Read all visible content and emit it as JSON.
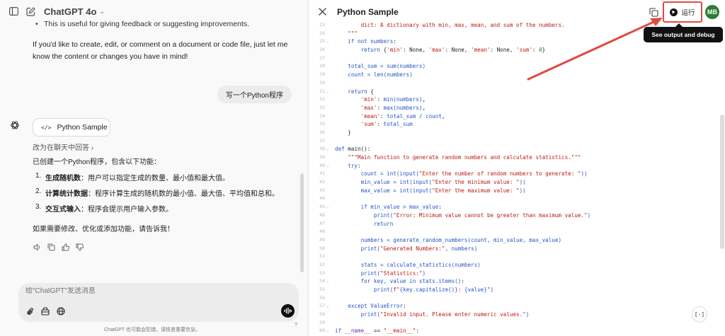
{
  "chat": {
    "model_name": "ChatGPT 4o",
    "cut_bullet": "This is useful for giving feedback or suggesting improvements.",
    "paragraph": "If you'd like to create, edit, or comment on a document or code file, just let me know the content or changes you have in mind!",
    "user_message": "写一个Python程序",
    "code_chip_label": "Python Sample",
    "reply_in_chat": "改为在聊天中回答",
    "intro": "已创建一个Python程序，包含以下功能：",
    "features": [
      {
        "num": "1.",
        "title": "生成随机数",
        "desc": "：用户可以指定生成的数量、最小值和最大值。"
      },
      {
        "num": "2.",
        "title": "计算统计数据",
        "desc": "：程序计算生成的随机数的最小值、最大值、平均值和总和。"
      },
      {
        "num": "3.",
        "title": "交互式输入",
        "desc": "：程序会提示用户输入参数。"
      }
    ],
    "outro": "如果需要修改、优化或添加功能，请告诉我！",
    "composer_placeholder": "给\"ChatGPT\"发送消息",
    "disclaimer": "ChatGPT 也可能会犯错。请核查重要信息。",
    "help": "?"
  },
  "editor": {
    "title": "Python Sample",
    "run_label": "运行",
    "tooltip": "See output and debug",
    "avatar_initials": "MB",
    "expand_label": "[-]",
    "lines": [
      {
        "n": "23",
        "fold": "",
        "segs": [
          {
            "c": "c-s",
            "t": "        dict: A dictionary with min, max, mean, and sum of the numbers."
          }
        ]
      },
      {
        "n": "24",
        "fold": "",
        "segs": [
          {
            "c": "c-s",
            "t": "    \"\"\""
          }
        ]
      },
      {
        "n": "25",
        "fold": "v",
        "segs": [
          {
            "c": "c-k",
            "t": "    if not "
          },
          {
            "c": "c-b",
            "t": "numbers"
          },
          {
            "c": "c-d",
            "t": ":"
          }
        ]
      },
      {
        "n": "26",
        "fold": "",
        "segs": [
          {
            "c": "c-k",
            "t": "        return "
          },
          {
            "c": "c-d",
            "t": "{"
          },
          {
            "c": "c-s",
            "t": "'min'"
          },
          {
            "c": "c-d",
            "t": ": None, "
          },
          {
            "c": "c-s",
            "t": "'max'"
          },
          {
            "c": "c-d",
            "t": ": None, "
          },
          {
            "c": "c-s",
            "t": "'mean'"
          },
          {
            "c": "c-d",
            "t": ": None, "
          },
          {
            "c": "c-s",
            "t": "'sum'"
          },
          {
            "c": "c-d",
            "t": ": "
          },
          {
            "c": "c-n",
            "t": "0"
          },
          {
            "c": "c-d",
            "t": "}"
          }
        ]
      },
      {
        "n": "27",
        "fold": "",
        "segs": []
      },
      {
        "n": "28",
        "fold": "",
        "segs": [
          {
            "c": "c-b",
            "t": "    total_sum = sum(numbers)"
          }
        ]
      },
      {
        "n": "29",
        "fold": "",
        "segs": [
          {
            "c": "c-b",
            "t": "    count = len(numbers)"
          }
        ]
      },
      {
        "n": "30",
        "fold": "",
        "segs": []
      },
      {
        "n": "31",
        "fold": "v",
        "segs": [
          {
            "c": "c-k",
            "t": "    return "
          },
          {
            "c": "c-d",
            "t": "{"
          }
        ]
      },
      {
        "n": "32",
        "fold": "",
        "segs": [
          {
            "c": "c-s",
            "t": "        'min'"
          },
          {
            "c": "c-d",
            "t": ": "
          },
          {
            "c": "c-b",
            "t": "min(numbers)"
          },
          {
            "c": "c-d",
            "t": ","
          }
        ]
      },
      {
        "n": "33",
        "fold": "",
        "segs": [
          {
            "c": "c-s",
            "t": "        'max'"
          },
          {
            "c": "c-d",
            "t": ": "
          },
          {
            "c": "c-b",
            "t": "max(numbers)"
          },
          {
            "c": "c-d",
            "t": ","
          }
        ]
      },
      {
        "n": "34",
        "fold": "",
        "segs": [
          {
            "c": "c-s",
            "t": "        'mean'"
          },
          {
            "c": "c-d",
            "t": ": "
          },
          {
            "c": "c-b",
            "t": "total_sum / count"
          },
          {
            "c": "c-d",
            "t": ","
          }
        ]
      },
      {
        "n": "35",
        "fold": "",
        "segs": [
          {
            "c": "c-s",
            "t": "        'sum'"
          },
          {
            "c": "c-d",
            "t": ": "
          },
          {
            "c": "c-b",
            "t": "total_sum"
          }
        ]
      },
      {
        "n": "36",
        "fold": "",
        "segs": [
          {
            "c": "c-d",
            "t": "    }"
          }
        ]
      },
      {
        "n": "37",
        "fold": "",
        "segs": []
      },
      {
        "n": "38",
        "fold": "v",
        "segs": [
          {
            "c": "c-k",
            "t": "def "
          },
          {
            "c": "c-d",
            "t": "main():"
          }
        ]
      },
      {
        "n": "39",
        "fold": "",
        "segs": [
          {
            "c": "c-s",
            "t": "    \"\"\"Main function to generate random numbers and calculate statistics.\"\"\""
          }
        ]
      },
      {
        "n": "40",
        "fold": "v",
        "segs": [
          {
            "c": "c-k",
            "t": "    try"
          },
          {
            "c": "c-d",
            "t": ":"
          }
        ]
      },
      {
        "n": "41",
        "fold": "",
        "segs": [
          {
            "c": "c-b",
            "t": "        count = int(input("
          },
          {
            "c": "c-s",
            "t": "\"Enter the number of random numbers to generate: \""
          },
          {
            "c": "c-b",
            "t": "))"
          }
        ]
      },
      {
        "n": "42",
        "fold": "",
        "segs": [
          {
            "c": "c-b",
            "t": "        min_value = int(input("
          },
          {
            "c": "c-s",
            "t": "\"Enter the minimum value: \""
          },
          {
            "c": "c-b",
            "t": "))"
          }
        ]
      },
      {
        "n": "43",
        "fold": "",
        "segs": [
          {
            "c": "c-b",
            "t": "        max_value = int(input("
          },
          {
            "c": "c-s",
            "t": "\"Enter the maximum value: \""
          },
          {
            "c": "c-b",
            "t": "))"
          }
        ]
      },
      {
        "n": "44",
        "fold": "",
        "segs": []
      },
      {
        "n": "45",
        "fold": "v",
        "segs": [
          {
            "c": "c-k",
            "t": "        if "
          },
          {
            "c": "c-b",
            "t": "min_value > max_value"
          },
          {
            "c": "c-d",
            "t": ":"
          }
        ]
      },
      {
        "n": "46",
        "fold": "",
        "segs": [
          {
            "c": "c-b",
            "t": "            print("
          },
          {
            "c": "c-s",
            "t": "\"Error: Minimum value cannot be greater than maximum value.\""
          },
          {
            "c": "c-b",
            "t": ")"
          }
        ]
      },
      {
        "n": "47",
        "fold": "",
        "segs": [
          {
            "c": "c-k",
            "t": "            return"
          }
        ]
      },
      {
        "n": "48",
        "fold": "",
        "segs": []
      },
      {
        "n": "49",
        "fold": "",
        "segs": [
          {
            "c": "c-b",
            "t": "        numbers = generate_random_numbers(count, min_value, max_value)"
          }
        ]
      },
      {
        "n": "50",
        "fold": "",
        "segs": [
          {
            "c": "c-b",
            "t": "        print("
          },
          {
            "c": "c-s",
            "t": "\"Generated Numbers:\""
          },
          {
            "c": "c-b",
            "t": ", numbers)"
          }
        ]
      },
      {
        "n": "51",
        "fold": "",
        "segs": []
      },
      {
        "n": "52",
        "fold": "",
        "segs": [
          {
            "c": "c-b",
            "t": "        stats = calculate_statistics(numbers)"
          }
        ]
      },
      {
        "n": "53",
        "fold": "",
        "segs": [
          {
            "c": "c-b",
            "t": "        print("
          },
          {
            "c": "c-s",
            "t": "\"Statistics:\""
          },
          {
            "c": "c-b",
            "t": ")"
          }
        ]
      },
      {
        "n": "54",
        "fold": "v",
        "segs": [
          {
            "c": "c-k",
            "t": "        for "
          },
          {
            "c": "c-b",
            "t": "key, value "
          },
          {
            "c": "c-k",
            "t": "in "
          },
          {
            "c": "c-b",
            "t": "stats.items()"
          },
          {
            "c": "c-d",
            "t": ":"
          }
        ]
      },
      {
        "n": "55",
        "fold": "",
        "segs": [
          {
            "c": "c-b",
            "t": "            print("
          },
          {
            "c": "c-s",
            "t": "f\""
          },
          {
            "c": "c-b",
            "t": "{key.capitalize()}"
          },
          {
            "c": "c-s",
            "t": ": "
          },
          {
            "c": "c-b",
            "t": "{value}"
          },
          {
            "c": "c-s",
            "t": "\""
          },
          {
            "c": "c-b",
            "t": ")"
          }
        ]
      },
      {
        "n": "56",
        "fold": "",
        "segs": []
      },
      {
        "n": "57",
        "fold": "v",
        "segs": [
          {
            "c": "c-k",
            "t": "    except "
          },
          {
            "c": "c-b",
            "t": "ValueError"
          },
          {
            "c": "c-d",
            "t": ":"
          }
        ]
      },
      {
        "n": "58",
        "fold": "",
        "segs": [
          {
            "c": "c-b",
            "t": "        print("
          },
          {
            "c": "c-s",
            "t": "\"Invalid input. Please enter numeric values.\""
          },
          {
            "c": "c-b",
            "t": ")"
          }
        ]
      },
      {
        "n": "59",
        "fold": "",
        "segs": []
      },
      {
        "n": "60",
        "fold": "v",
        "segs": [
          {
            "c": "c-k",
            "t": "if "
          },
          {
            "c": "c-p",
            "t": "__name__"
          },
          {
            "c": "c-d",
            "t": " == "
          },
          {
            "c": "c-s",
            "t": "\"__main__\""
          },
          {
            "c": "c-d",
            "t": ":"
          }
        ]
      }
    ]
  },
  "colors": {
    "accent_red": "#e14a43",
    "avatar_green": "#2e7d32"
  },
  "icons": [
    "sidebar-toggle-icon",
    "new-chat-icon",
    "chevron-down-icon",
    "openai-logo-icon",
    "code-icon",
    "chevron-right-icon",
    "speaker-icon",
    "copy-icon",
    "thumbs-up-icon",
    "thumbs-down-icon",
    "attach-icon",
    "tools-icon",
    "globe-icon",
    "voice-icon",
    "close-icon",
    "play-icon",
    "expand-icon"
  ]
}
